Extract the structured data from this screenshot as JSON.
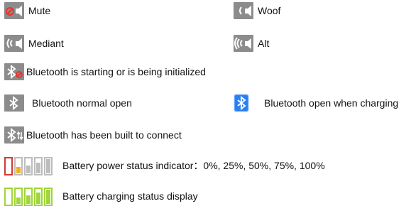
{
  "legend": {
    "mute": {
      "label": "Mute",
      "icon": "speaker-mute-icon"
    },
    "woof": {
      "label": "Woof",
      "icon": "speaker-low-icon"
    },
    "mediant": {
      "label": "Mediant",
      "icon": "speaker-medium-icon"
    },
    "alt": {
      "label": "Alt",
      "icon": "speaker-high-icon"
    },
    "bt_starting": {
      "label": "Bluetooth is starting or is being initialized",
      "icon": "bluetooth-starting-icon"
    },
    "bt_open": {
      "label": "Bluetooth normal open",
      "icon": "bluetooth-icon"
    },
    "bt_charging": {
      "label": "Bluetooth open when charging",
      "icon": "bluetooth-charging-icon"
    },
    "bt_connect": {
      "label": "Bluetooth has been built to connect",
      "icon": "bluetooth-connected-icon"
    },
    "battery_power": {
      "label": "Battery power status indicator：0%, 25%, 50%, 75%, 100%",
      "icon": "battery-levels-icon"
    },
    "battery_charging": {
      "label": "Battery charging status display",
      "icon": "battery-charging-icon"
    }
  },
  "colors": {
    "icon_bg": "#8c8c8c",
    "mute_red": "#e8342c",
    "bt_blue": "#2a7ff0",
    "battery_empty_red": "#d13b2e",
    "battery_low_yellow": "#f2b01e",
    "battery_green": "#9fd63a",
    "battery_gray": "#bdbdbd"
  }
}
